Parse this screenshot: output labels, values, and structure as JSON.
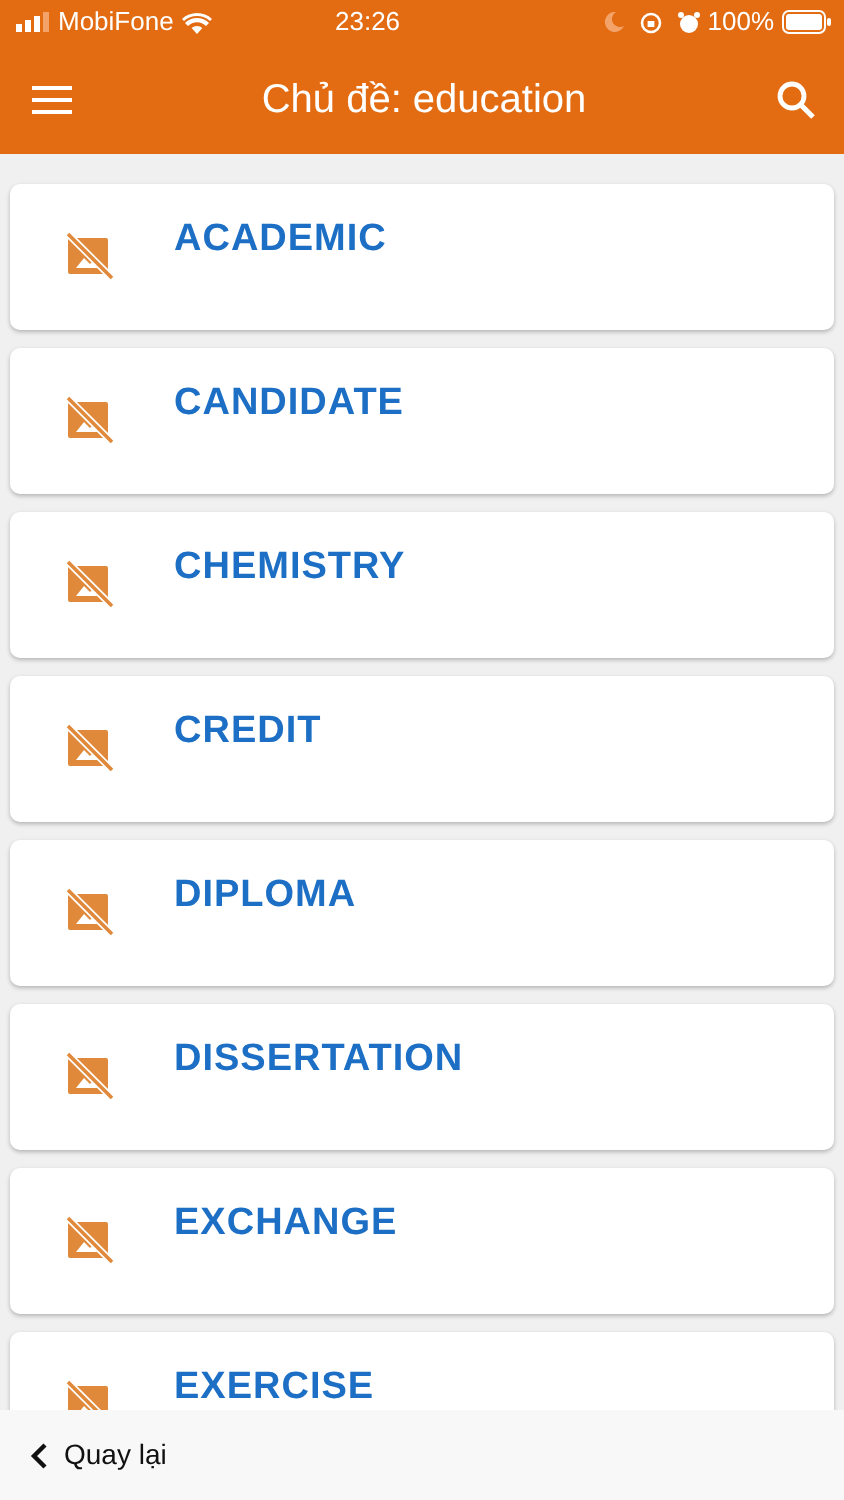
{
  "status_bar": {
    "carrier": "MobiFone",
    "time": "23:26",
    "battery": "100%"
  },
  "app_bar": {
    "title": "Chủ đề: education"
  },
  "topics": [
    {
      "title": "ACADEMIC"
    },
    {
      "title": "CANDIDATE"
    },
    {
      "title": "CHEMISTRY"
    },
    {
      "title": "CREDIT"
    },
    {
      "title": "DIPLOMA"
    },
    {
      "title": "DISSERTATION"
    },
    {
      "title": "EXCHANGE"
    },
    {
      "title": "EXERCISE"
    }
  ],
  "bottom_bar": {
    "back_label": "Quay lại"
  }
}
